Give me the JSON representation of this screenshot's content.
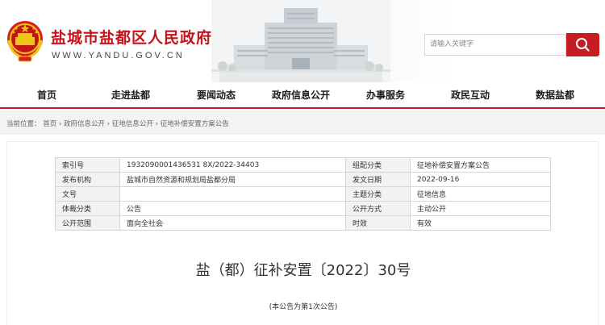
{
  "header": {
    "site_title": "盐城市盐都区人民政府",
    "site_domain": "WWW.YANDU.GOV.CN",
    "search_placeholder": "请输入关键字"
  },
  "nav": {
    "items": [
      "首页",
      "走进盐都",
      "要闻动态",
      "政府信息公开",
      "办事服务",
      "政民互动",
      "数据盐都"
    ]
  },
  "breadcrumb": {
    "label": "当前位置：",
    "items": [
      "首页",
      "政府信息公开",
      "征地信息公开",
      "征地补偿安置方案公告"
    ],
    "separator": "›"
  },
  "meta_table": {
    "rows": [
      {
        "k1": "索引号",
        "v1": "1932090001436531 8X/2022-34403",
        "k2": "组配分类",
        "v2": "征地补偿安置方案公告"
      },
      {
        "k1": "发布机构",
        "v1": "盐城市自然资源和规划局盐都分局",
        "k2": "发文日期",
        "v2": "2022-09-16"
      },
      {
        "k1": "文号",
        "v1": "",
        "k2": "主题分类",
        "v2": "征地信息"
      },
      {
        "k1": "体裁分类",
        "v1": "公告",
        "k2": "公开方式",
        "v2": "主动公开"
      },
      {
        "k1": "公开范围",
        "v1": "面向全社会",
        "k2": "时效",
        "v2": "有效"
      }
    ]
  },
  "document": {
    "title": "盐（都）征补安置〔2022〕30号",
    "subtitle": "(本公告为第1次公告)"
  },
  "colors": {
    "brand_red": "#c41a20",
    "search_button": "#c51c24"
  },
  "icons": {
    "emblem": "national-emblem-icon",
    "search": "magnifier-icon"
  }
}
